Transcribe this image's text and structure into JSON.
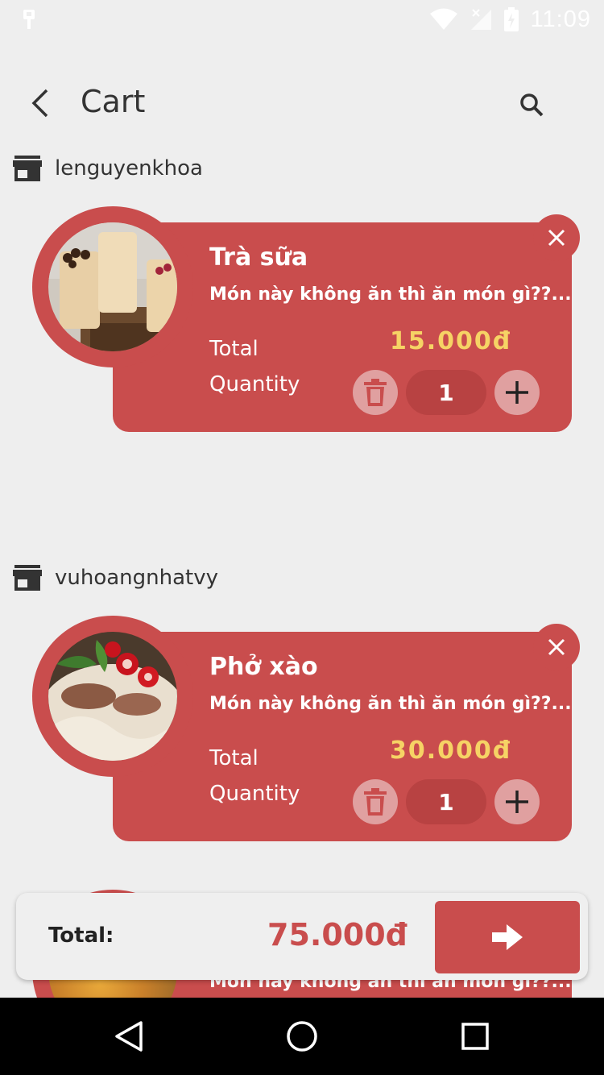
{
  "status_bar": {
    "time": "11:09"
  },
  "header": {
    "title": "Cart"
  },
  "shops": [
    {
      "name": "lenguyenkhoa",
      "item": {
        "name": "Trà sữa",
        "description": "Món này không ăn thì ăn món gì??...",
        "total_label": "Total",
        "price": "15.000đ",
        "quantity_label": "Quantity",
        "quantity": "1"
      }
    },
    {
      "name": "vuhoangnhatvy",
      "item": {
        "name": "Phở xào",
        "description": "Món này không ăn thì ăn món gì??...",
        "total_label": "Total",
        "price": "30.000đ",
        "quantity_label": "Quantity",
        "quantity": "1"
      }
    }
  ],
  "partial_item": {
    "description": "Món này không ăn thì ăn món gì??..."
  },
  "footer": {
    "total_label": "Total:",
    "total_value": "75.000đ"
  },
  "colors": {
    "accent": "#c94d4d",
    "price": "#f6d365",
    "background": "#eeeeee"
  },
  "icons": [
    "back-icon",
    "search-icon",
    "shop-icon",
    "close-icon",
    "trash-icon",
    "plus-icon",
    "arrow-right-icon",
    "nav-back-icon",
    "nav-home-icon",
    "nav-recents-icon"
  ]
}
